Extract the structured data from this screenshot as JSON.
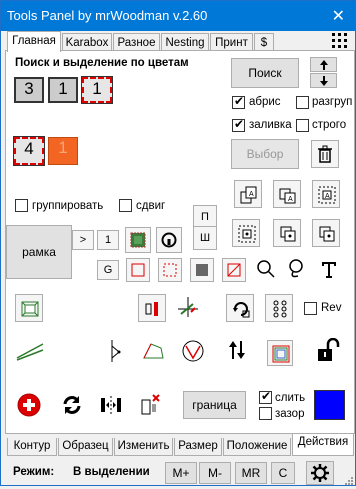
{
  "window": {
    "title": "Tools Panel by mrWoodman v.2.60",
    "close": "✕"
  },
  "tabs": [
    {
      "label": "Главная"
    },
    {
      "label": "Karabox"
    },
    {
      "label": "Разное"
    },
    {
      "label": "Nesting"
    },
    {
      "label": "Принт"
    },
    {
      "label": "$"
    }
  ],
  "main": {
    "heading": "Поиск и выделение по цветам",
    "count_buttons": [
      "3",
      "1",
      "1"
    ],
    "search_button": "Поиск",
    "abris_label": "абрис",
    "razgrup_label": "разгруп",
    "zalivka_label": "заливка",
    "strogo_label": "строго",
    "select_button": "Выбор",
    "box4": "4",
    "box_orange": "1",
    "group_label": "группировать",
    "shift_label": "сдвиг",
    "frame_button": "рамка",
    "gt": ">",
    "one": "1",
    "p": "П",
    "sh": "Ш",
    "g": "G",
    "rev_label": "Rev",
    "border_button": "граница",
    "slit_label": "слить",
    "zazor_label": "зазор",
    "accent": "#0000ff"
  },
  "bottom_tabs": [
    {
      "label": "Контур"
    },
    {
      "label": "Образец"
    },
    {
      "label": "Изменить"
    },
    {
      "label": "Размер"
    },
    {
      "label": "Положение"
    },
    {
      "label": "Действия"
    }
  ],
  "status": {
    "mode_label": "Режим:",
    "mode_value": "В выделении",
    "m_plus": "M+",
    "m_minus": "M-",
    "mr": "MR",
    "c": "C"
  }
}
